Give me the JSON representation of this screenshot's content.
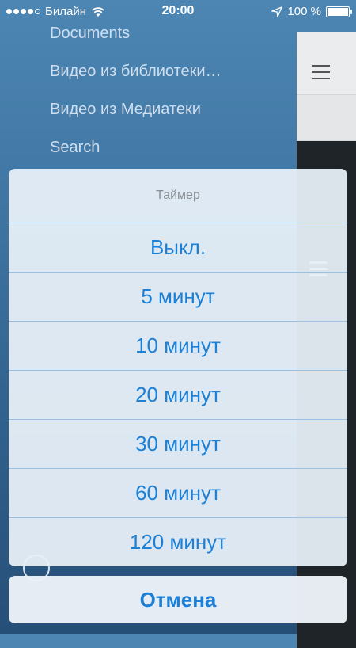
{
  "status_bar": {
    "carrier": "Билайн",
    "time": "20:00",
    "battery": "100 %"
  },
  "side_menu": {
    "items": [
      {
        "label": "Documents"
      },
      {
        "label": "Видео из библиотеки…"
      },
      {
        "label": "Видео из Медиатеки"
      },
      {
        "label": "Search"
      }
    ]
  },
  "action_sheet": {
    "title": "Таймер",
    "options": [
      {
        "label": "Выкл."
      },
      {
        "label": "5 минут"
      },
      {
        "label": "10 минут"
      },
      {
        "label": "20 минут"
      },
      {
        "label": "30 минут"
      },
      {
        "label": "60 минут"
      },
      {
        "label": "120 минут"
      }
    ],
    "cancel_label": "Отмена"
  },
  "colors": {
    "accent": "#1b80d6",
    "separator": "#9ac1e2"
  }
}
